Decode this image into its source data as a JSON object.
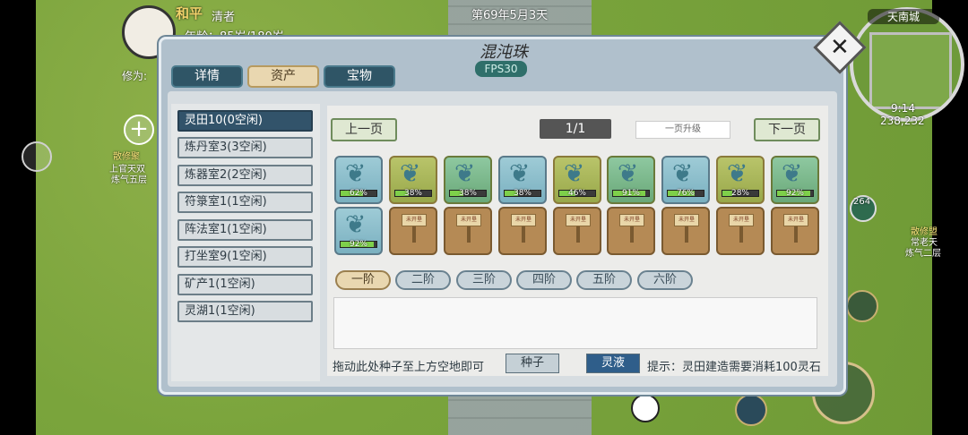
{
  "game": {
    "date_text": "第69年5月3天",
    "player": {
      "name": "和平",
      "title": "清者",
      "age_text": "年龄：85岁/180岁",
      "cultivation_label": "修为:"
    },
    "minimap": {
      "city": "天南城",
      "time": "9:14",
      "coords": "238,232"
    },
    "side_badge_count": "264",
    "npc_labels": [
      "散修聚",
      "上官天双",
      "炼气五层",
      "散修盟",
      "常老天",
      "炼气二层"
    ]
  },
  "panel": {
    "title": "混沌珠",
    "fps": "FPS30",
    "tabs": [
      {
        "label": "详情",
        "active": false
      },
      {
        "label": "资产",
        "active": true
      },
      {
        "label": "宝物",
        "active": false
      }
    ],
    "facilities": [
      {
        "label": "灵田10(0空闲)",
        "active": true
      },
      {
        "label": "炼丹室3(3空闲)",
        "active": false
      },
      {
        "label": "炼器室2(2空闲)",
        "active": false
      },
      {
        "label": "符箓室1(1空闲)",
        "active": false
      },
      {
        "label": "阵法室1(1空闲)",
        "active": false
      },
      {
        "label": "打坐室9(1空闲)",
        "active": false
      },
      {
        "label": "矿产1(1空闲)",
        "active": false
      },
      {
        "label": "灵湖1(1空闲)",
        "active": false
      }
    ],
    "prev_page": "上一页",
    "next_page": "下一页",
    "page_indicator": "1/1",
    "upgrade_label": "一页升级",
    "fields": [
      {
        "type": "plant",
        "progress": 62,
        "label": "62%"
      },
      {
        "type": "plant",
        "progress": 38,
        "label": "38%"
      },
      {
        "type": "plant",
        "progress": 38,
        "label": "38%"
      },
      {
        "type": "plant",
        "progress": 38,
        "label": "38%"
      },
      {
        "type": "plant",
        "progress": 46,
        "label": "46%"
      },
      {
        "type": "plant",
        "progress": 91,
        "label": "91%"
      },
      {
        "type": "plant",
        "progress": 76,
        "label": "76%"
      },
      {
        "type": "plant",
        "progress": 28,
        "label": "28%"
      },
      {
        "type": "plant",
        "progress": 92,
        "label": "92%"
      },
      {
        "type": "plant",
        "progress": 92,
        "label": "92%"
      },
      {
        "type": "empty",
        "sign": "未开垦"
      },
      {
        "type": "empty",
        "sign": "未开垦"
      },
      {
        "type": "empty",
        "sign": "未开垦"
      },
      {
        "type": "empty",
        "sign": "未开垦"
      },
      {
        "type": "empty",
        "sign": "未开垦"
      },
      {
        "type": "empty",
        "sign": "未开垦"
      },
      {
        "type": "empty",
        "sign": "未开垦"
      },
      {
        "type": "empty",
        "sign": "未开垦"
      }
    ],
    "grade_tabs": [
      {
        "label": "一阶",
        "active": true
      },
      {
        "label": "二阶",
        "active": false
      },
      {
        "label": "三阶",
        "active": false
      },
      {
        "label": "四阶",
        "active": false
      },
      {
        "label": "五阶",
        "active": false
      },
      {
        "label": "六阶",
        "active": false
      }
    ],
    "drag_hint": "拖动此处种子至上方空地即可",
    "seed_button": "种子",
    "liquid_button": "灵液",
    "tip": "提示：灵田建造需要消耗100灵石"
  }
}
